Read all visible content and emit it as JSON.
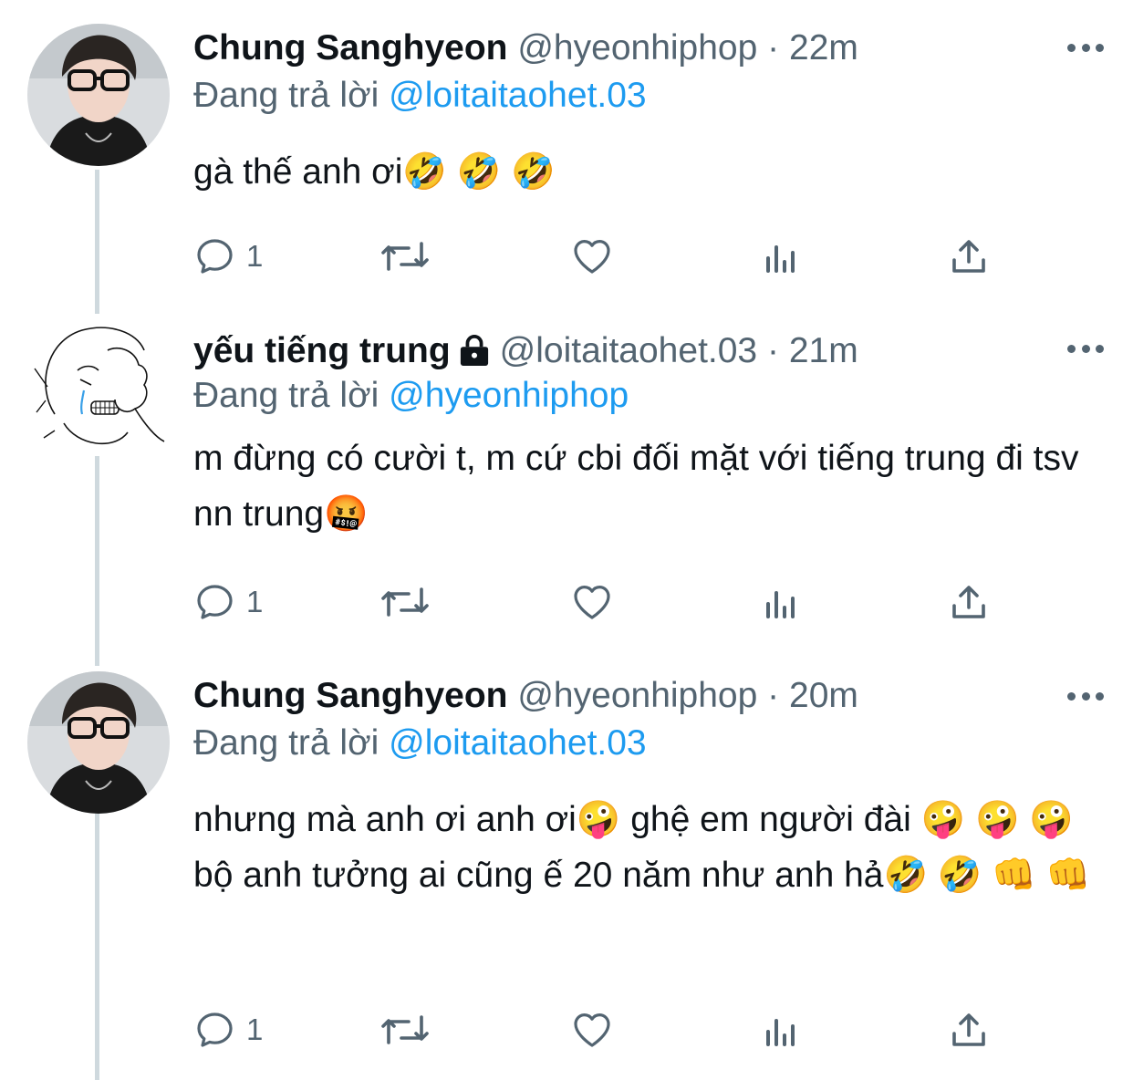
{
  "tweets": [
    {
      "name": "Chung Sanghyeon",
      "handle": "@hyeonhiphop",
      "dot": "·",
      "time": "22m",
      "reply_prefix": "Đang trả lời",
      "reply_to": "@loitaitaohet.03",
      "text": "gà thế anh ơi🤣 🤣 🤣",
      "reply_count": "1",
      "locked": false
    },
    {
      "name": "yếu tiếng trung",
      "handle": "@loitaitaohet.03",
      "dot": "·",
      "time": "21m",
      "reply_prefix": "Đang trả lời",
      "reply_to": "@hyeonhiphop",
      "text": "m đừng có cười t, m cứ cbi đối mặt với tiếng trung đi tsv nn trung🤬",
      "reply_count": "1",
      "locked": true
    },
    {
      "name": "Chung Sanghyeon",
      "handle": "@hyeonhiphop",
      "dot": "·",
      "time": "20m",
      "reply_prefix": "Đang trả lời",
      "reply_to": "@loitaitaohet.03",
      "text": "nhưng mà anh ơi anh ơi🤪 ghệ em người đài 🤪 🤪 🤪  bộ anh tưởng ai cũng ế 20 năm như anh hả🤣 🤣 👊 👊",
      "reply_count": "1",
      "locked": false
    }
  ],
  "icons": {
    "reply": "reply-icon",
    "retweet": "retweet-icon",
    "like": "heart-icon",
    "views": "analytics-icon",
    "share": "share-icon",
    "more": "more-icon",
    "lock": "lock-icon"
  },
  "colors": {
    "text": "#0f1419",
    "secondary": "#536471",
    "link": "#1d9bf0",
    "thread_line": "#cfd9de"
  }
}
